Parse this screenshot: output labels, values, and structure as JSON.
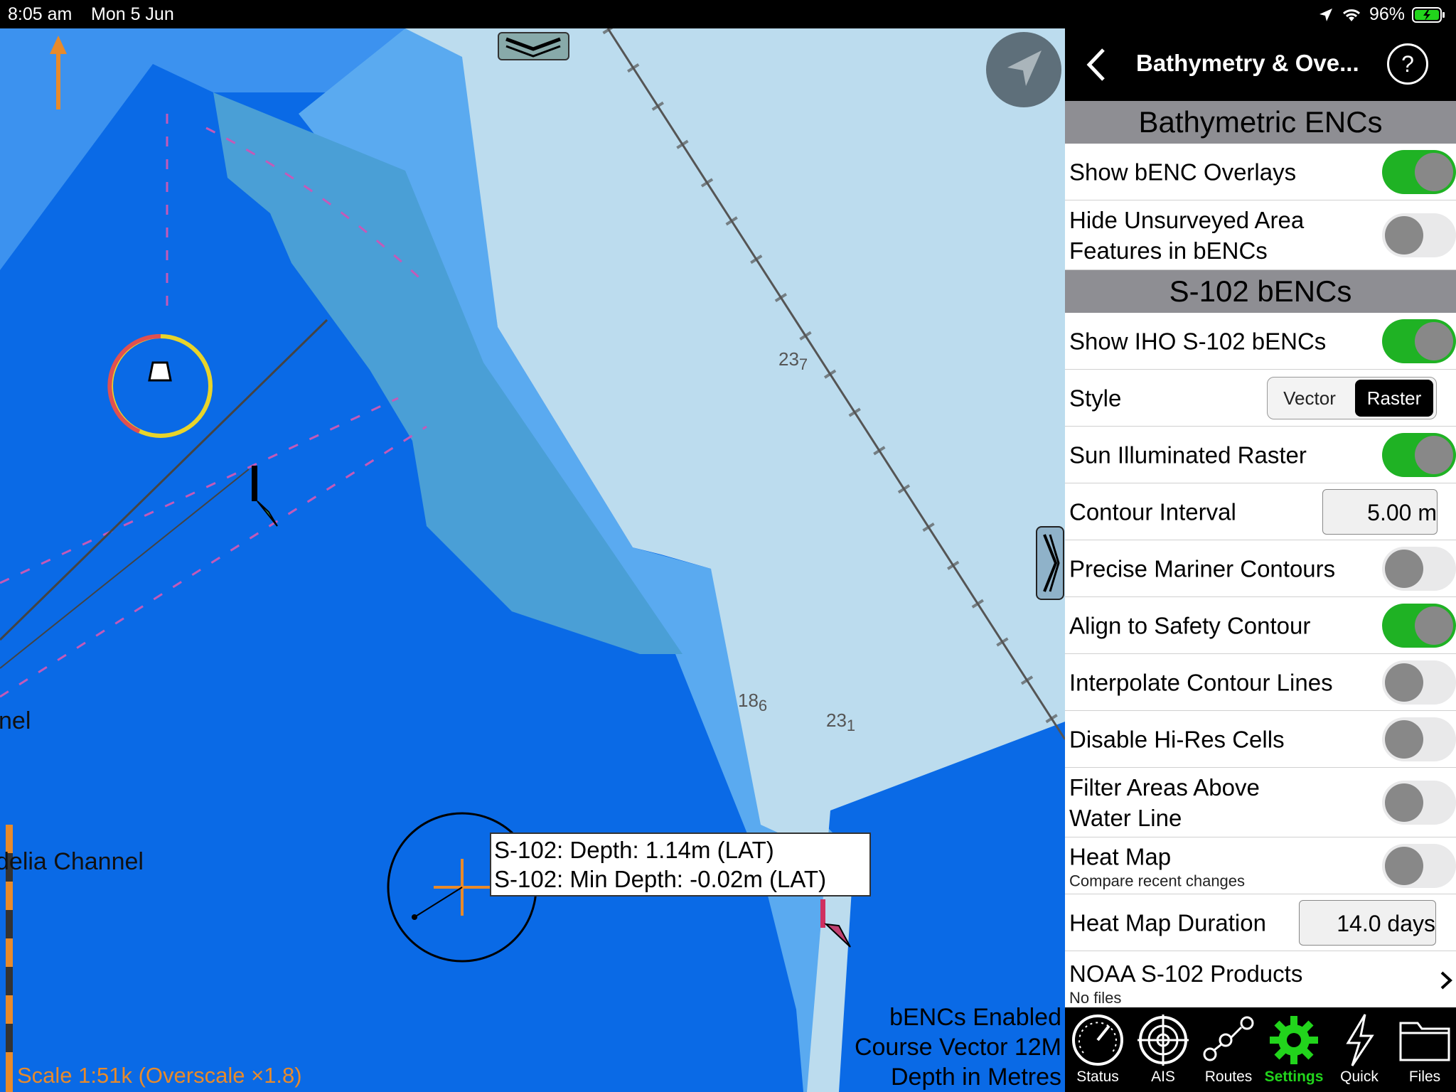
{
  "status_bar": {
    "time": "8:05 am",
    "date": "Mon 5 Jun",
    "battery": "96%"
  },
  "map": {
    "soundings": [
      {
        "main": "23",
        "sub": "7"
      },
      {
        "main": "18",
        "sub": "6"
      },
      {
        "main": "23",
        "sub": "1"
      }
    ],
    "channel_label_1": "nel",
    "channel_label_2": "delia Channel",
    "depth_popup": {
      "line1": "S-102: Depth: 1.14m (LAT)",
      "line2": "S-102: Min Depth: -0.02m (LAT)"
    },
    "overlay_status": {
      "line1": "bENCs Enabled",
      "line2": "Course Vector 12M",
      "line3": "Depth in Metres"
    },
    "scale_text": "Scale 1:51k (Overscale ×1.8)",
    "north_label": "N"
  },
  "panel": {
    "title": "Bathymetry & Ove...",
    "help_label": "?",
    "section1": "Bathymetric ENCs",
    "show_benc": "Show bENC Overlays",
    "hide_unsurveyed_1": "Hide Unsurveyed Area",
    "hide_unsurveyed_2": "Features in bENCs",
    "section2": "S-102 bENCs",
    "show_iho": "Show IHO S-102 bENCs",
    "style_label": "Style",
    "style_options": [
      "Vector",
      "Raster"
    ],
    "style_selected": "Raster",
    "sun_illuminated": "Sun Illuminated Raster",
    "contour_interval_label": "Contour Interval",
    "contour_interval_value": "5.00  m",
    "precise_contours": "Precise Mariner Contours",
    "align_safety": "Align to Safety Contour",
    "interpolate": "Interpolate Contour Lines",
    "disable_hires": "Disable Hi-Res Cells",
    "filter_areas_1": "Filter Areas Above",
    "filter_areas_2": "Water Line",
    "heat_map": "Heat Map",
    "heat_map_sub": "Compare recent changes",
    "heat_map_duration_label": "Heat Map Duration",
    "heat_map_duration_value": "14.0  days",
    "noaa_products": "NOAA S-102 Products",
    "noaa_sub": "No files"
  },
  "toggles": {
    "show_benc": true,
    "hide_unsurveyed": false,
    "show_iho": true,
    "sun_illuminated": true,
    "precise_contours": false,
    "align_safety": true,
    "interpolate": false,
    "disable_hires": false,
    "filter_areas": false,
    "heat_map": false
  },
  "tabs": [
    {
      "label": "Status",
      "icon": "gauge-icon"
    },
    {
      "label": "AIS",
      "icon": "radar-icon"
    },
    {
      "label": "Routes",
      "icon": "route-icon"
    },
    {
      "label": "Settings",
      "icon": "gear-icon",
      "active": true
    },
    {
      "label": "Quick",
      "icon": "lightning-icon"
    },
    {
      "label": "Files",
      "icon": "folder-icon"
    }
  ],
  "colors": {
    "accent_green": "#1fb224",
    "active_tab": "#22d41c",
    "deep_water": "#0a6ae6",
    "shallow_water": "#5aaaf0",
    "land_shoal": "#bcdcee"
  }
}
